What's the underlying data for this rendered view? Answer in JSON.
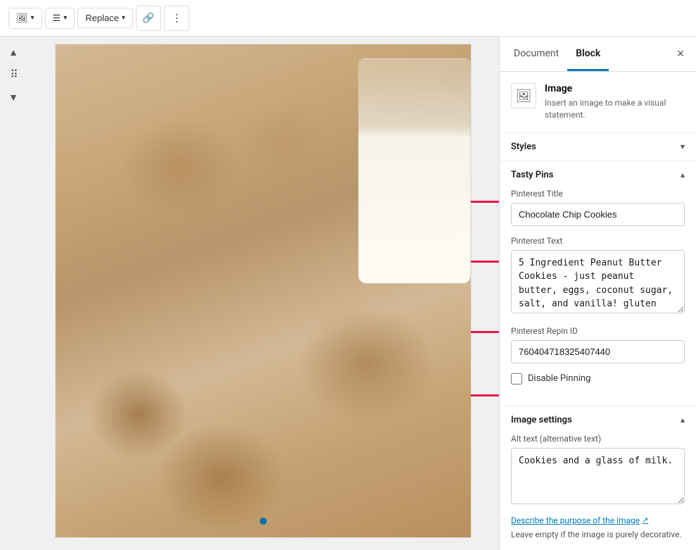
{
  "toolbar": {
    "image_icon": "🖼",
    "align_icon": "☰",
    "replace_label": "Replace",
    "replace_chevron": "▾",
    "link_icon": "🔗",
    "more_icon": "⋮"
  },
  "left_controls": {
    "up_icon": "▲",
    "drag_icon": "⠿",
    "down_icon": "▼"
  },
  "panel": {
    "document_tab": "Document",
    "block_tab": "Block",
    "close_icon": "×",
    "image_section": {
      "icon": "🖼",
      "title": "Image",
      "description": "Insert an image to make a visual statement."
    },
    "styles_section": {
      "title": "Styles",
      "chevron": "▾"
    },
    "tasty_pins_section": {
      "title": "Tasty Pins",
      "chevron": "▴"
    },
    "pinterest_title_label": "Pinterest Title",
    "pinterest_title_value": "Chocolate Chip Cookies",
    "pinterest_text_label": "Pinterest Text",
    "pinterest_text_value": "5 Ingredient Peanut Butter Cookies - just peanut butter, eggs, coconut sugar, salt, and vanilla! gluten free and refined sugar free. #glutenfree",
    "pinterest_repin_label": "Pinterest Repin ID",
    "pinterest_repin_value": "760404718325407440",
    "disable_pinning_label": "Disable Pinning",
    "image_settings_section": {
      "title": "Image settings",
      "chevron": "▴"
    },
    "alt_text_label": "Alt text (alternative text)",
    "alt_text_value": "Cookies and a glass of milk.",
    "alt_link_text": "Describe the purpose of the image",
    "alt_link_icon": "↗",
    "alt_note": "Leave empty if the image is purely decorative."
  }
}
